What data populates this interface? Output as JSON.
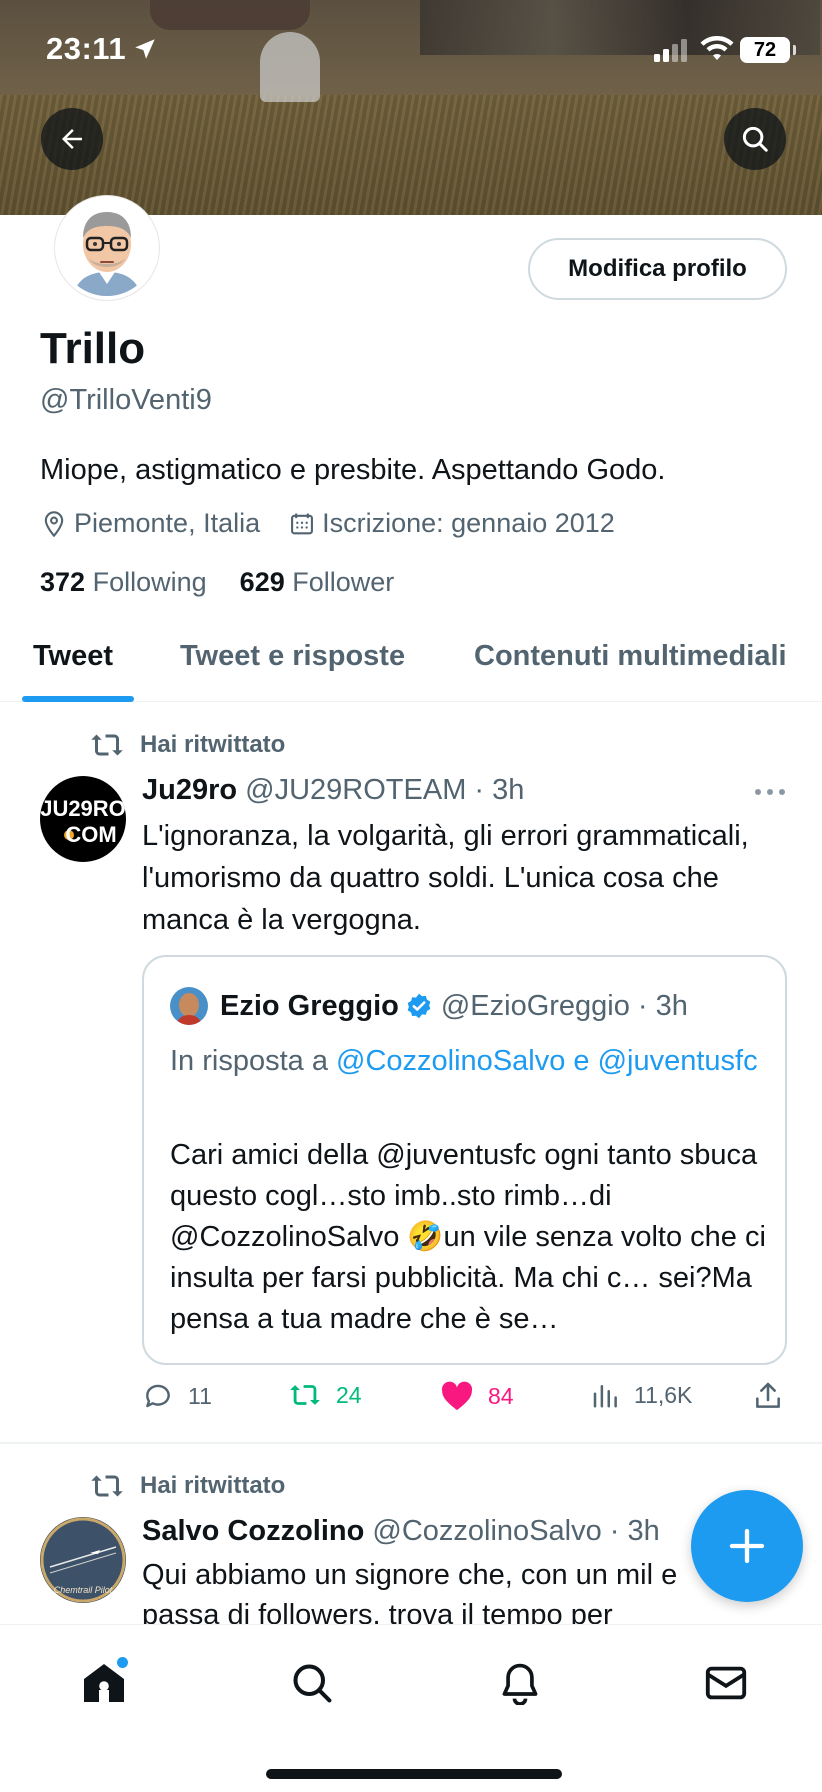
{
  "status_bar": {
    "time": "23:11",
    "battery": "72"
  },
  "profile": {
    "name": "Trillo",
    "handle": "@TrilloVenti9",
    "bio": "Miope, astigmatico e presbite. Aspettando Godo.",
    "location": "Piemonte, Italia",
    "joined": "Iscrizione: gennaio 2012",
    "following_count": "372",
    "following_label": "Following",
    "followers_count": "629",
    "followers_label": "Follower",
    "edit_button": "Modifica profilo"
  },
  "tabs": [
    {
      "label": "Tweet",
      "active": true
    },
    {
      "label": "Tweet e risposte",
      "active": false
    },
    {
      "label": "Contenuti multimediali",
      "active": false
    }
  ],
  "tweets": [
    {
      "retweet_label": "Hai ritwittato",
      "avatar_text": {
        "line1": "JU29RO",
        "line2": "COM"
      },
      "name": "Ju29ro",
      "handle": "@JU29ROTEAM · 3h",
      "text": "L'ignoranza, la volgarità, gli errori grammaticali, l'umorismo da quattro soldi. L'unica cosa che manca è la vergogna.",
      "quote": {
        "name": "Ezio Greggio",
        "handle": "@EzioGreggio · 3h",
        "reply_prefix": "In risposta a ",
        "reply_link_1": "@CozzolinoSalvo",
        "reply_and": " e ",
        "reply_link_2": "@juventusfc",
        "text": "Cari amici della @juventusfc ogni tanto sbuca questo cogl…sto imb..sto rimb…di @CozzolinoSalvo 🤣un vile senza volto che ci insulta per farsi pubblicità. Ma chi c… sei?Ma pensa a tua madre che è se…"
      },
      "replies": "11",
      "retweets": "24",
      "likes": "84",
      "views": "11,6K"
    },
    {
      "retweet_label": "Hai ritwittato",
      "avatar_text": "Chemtrail Pilot",
      "name": "Salvo Cozzolino",
      "handle": "@CozzolinoSalvo · 3h",
      "text": "Qui abbiamo un signore che, con un mil e passa di followers, trova il tempo per"
    }
  ],
  "colors": {
    "accent": "#1d9bf0",
    "retweet_green": "#00ba7c",
    "like_pink": "#f91880",
    "secondary_text": "#536471"
  }
}
